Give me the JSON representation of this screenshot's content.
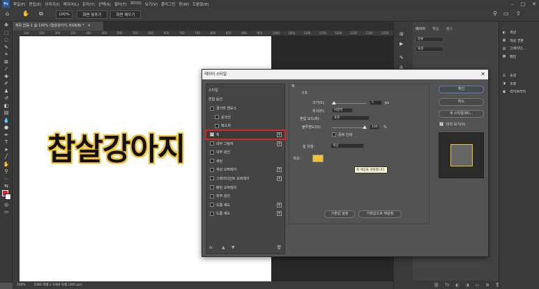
{
  "menubar": {
    "logo": "Ps",
    "items": [
      "파일(F)",
      "편집(E)",
      "이미지(I)",
      "레이어(L)",
      "문자(Y)",
      "선택(S)",
      "필터(T)",
      "3D(D)",
      "보기(V)",
      "플러그인",
      "창(W)",
      "도움말(H)"
    ],
    "controls": [
      "–",
      "□",
      "✕"
    ]
  },
  "optbar": {
    "zoom_value": "100%",
    "fit_screen": "화면 맞추기",
    "fill_screen": "화면 채우기"
  },
  "doc_tab": {
    "title": "제목 없음-1 @ 100% (찹살강아지, RGB/8) *",
    "close": "×"
  },
  "ruler_ticks": [
    "200",
    "250",
    "300",
    "350",
    "400",
    "450",
    "500",
    "550",
    "600",
    "650",
    "700",
    "750",
    "800",
    "850",
    "900",
    "950",
    "1000",
    "1050",
    "1100",
    "1150",
    "1200",
    "1250",
    "1300",
    "1350"
  ],
  "canvas": {
    "text": "찹살강아지"
  },
  "statusbar": {
    "zoom": "100%",
    "doc_info": "1080 픽셀 x 1080 픽셀 (300 ppi)"
  },
  "layers_panel": {
    "tabs": [
      "레이어",
      "채널",
      "패스"
    ],
    "search": "종류",
    "mode": "표준"
  },
  "right_panels": {
    "group1": [
      {
        "icon": "palette-icon",
        "label": "색상"
      },
      {
        "icon": "swatches-icon",
        "label": "색상 견본"
      },
      {
        "icon": "gradient-icon",
        "label": "그레이디..."
      },
      {
        "icon": "pattern-icon",
        "label": "패턴"
      }
    ],
    "group2": [
      {
        "icon": "properties-icon",
        "label": "속성"
      },
      {
        "icon": "adjustments-icon",
        "label": "조정"
      },
      {
        "icon": "libraries-icon",
        "label": "라이브러리"
      }
    ]
  },
  "dialog": {
    "title": "레이어 스타일",
    "close": "✕",
    "styles_header": "스타일",
    "blend_options": "혼합 옵션",
    "effects": [
      {
        "label": "경사와 엠보스",
        "checkbox": true,
        "plus": false,
        "indent": false
      },
      {
        "label": "윤곽선",
        "checkbox": true,
        "plus": false,
        "indent": true
      },
      {
        "label": "텍스처",
        "checkbox": true,
        "plus": false,
        "indent": true
      },
      {
        "label": "획",
        "checkbox": true,
        "checked": true,
        "plus": true,
        "indent": false,
        "selected": true
      },
      {
        "label": "내부 그림자",
        "checkbox": true,
        "plus": true,
        "indent": false
      },
      {
        "label": "내부 광선",
        "checkbox": true,
        "plus": false,
        "indent": false
      },
      {
        "label": "새틴",
        "checkbox": true,
        "plus": false,
        "indent": false
      },
      {
        "label": "색상 오버레이",
        "checkbox": true,
        "plus": true,
        "indent": false
      },
      {
        "label": "그레이디언트 오버레이",
        "checkbox": true,
        "plus": true,
        "indent": false
      },
      {
        "label": "패턴 오버레이",
        "checkbox": true,
        "plus": false,
        "indent": false
      },
      {
        "label": "외부 광선",
        "checkbox": true,
        "plus": false,
        "indent": false
      },
      {
        "label": "드롭 섀도",
        "checkbox": true,
        "plus": true,
        "indent": false
      },
      {
        "label": "드롭 섀도",
        "checkbox": true,
        "plus": true,
        "indent": false
      }
    ],
    "footer_fx": "fx.",
    "section_title": "획",
    "structure_title": "구조",
    "size_label": "크기(S):",
    "size_value": "5",
    "size_unit": "px",
    "position_label": "위치(P):",
    "position_value": "바깥쪽",
    "blend_mode_label": "혼합 모드(B):",
    "blend_mode_value": "표준",
    "opacity_label": "불투명도(O):",
    "opacity_value": "100",
    "opacity_unit": "%",
    "overprint_label": "중복 인쇄",
    "fill_type_label": "칠 유형:",
    "fill_type_value": "색상",
    "color_label": "색상:",
    "stroke_color": "#f4c430",
    "tooltip": "획 색상을 설정합니다.",
    "default_button": "기본값 설정",
    "reset_button": "기본값으로 재설정",
    "ok_button": "확인",
    "cancel_button": "취소",
    "new_style_button": "새 스타일(W)...",
    "preview_label": "미리 보기(V)"
  }
}
